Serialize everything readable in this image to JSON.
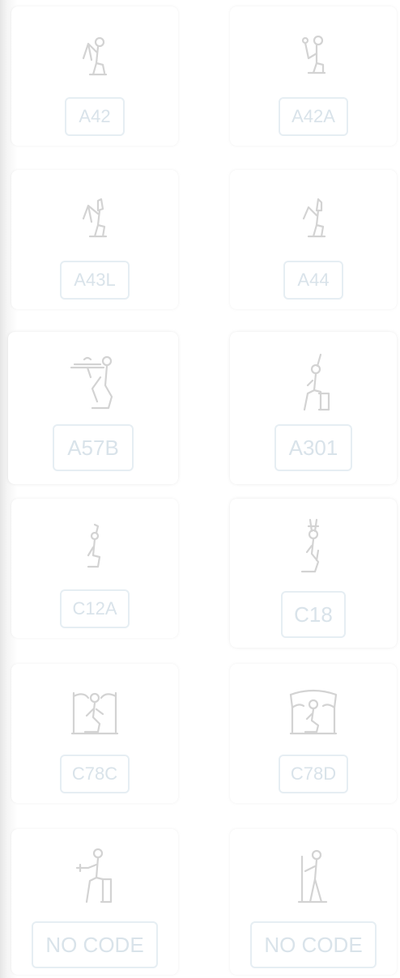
{
  "signs": [
    {
      "code": "A42",
      "glyph": "seated-man-flail-icon"
    },
    {
      "code": "A42A",
      "glyph": "seated-man-staff-icon"
    },
    {
      "code": "A43L",
      "glyph": "seated-king-crown-left-icon"
    },
    {
      "code": "A44",
      "glyph": "seated-king-white-crown-icon"
    },
    {
      "code": "A57B",
      "glyph": "kneeling-offering-table-icon"
    },
    {
      "code": "A301",
      "glyph": "seated-on-throne-icon"
    },
    {
      "code": "C12A",
      "glyph": "small-seated-deity-icon"
    },
    {
      "code": "C18",
      "glyph": "kneeling-deity-plumes-icon"
    },
    {
      "code": "C78C",
      "glyph": "kneeling-god-between-poles-icon"
    },
    {
      "code": "C78D",
      "glyph": "kneeling-god-under-canopy-icon"
    },
    {
      "code": "NO CODE",
      "glyph": "seated-figure-holding-object-icon"
    },
    {
      "code": "NO CODE",
      "glyph": "standing-figure-with-staff-icon"
    }
  ],
  "colors": {
    "glyph_stroke": "#d3d3d3",
    "code_text": "#d9e3ea",
    "code_border": "#e6eef3"
  }
}
